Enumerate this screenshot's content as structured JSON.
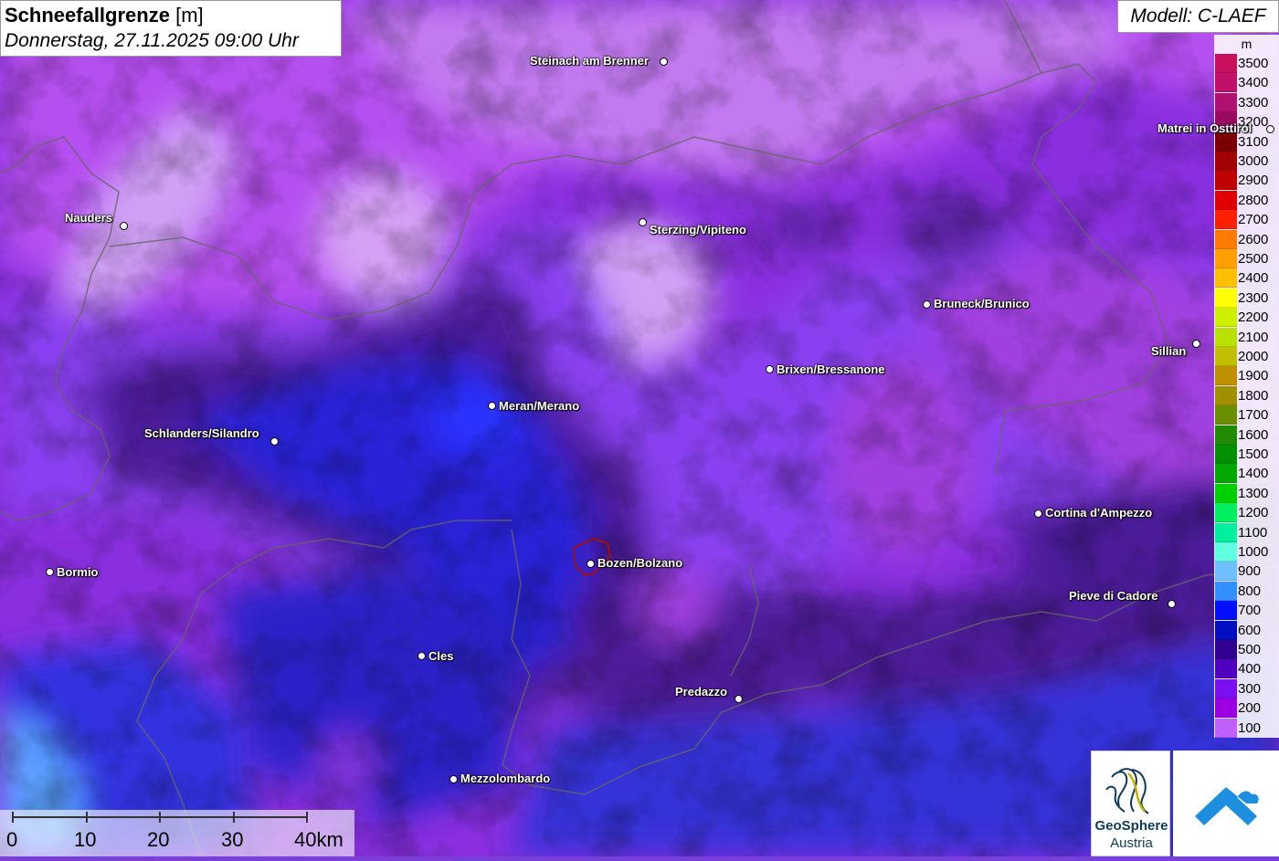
{
  "title": {
    "main": "Schneefallgrenze",
    "unit": "[m]",
    "datetime": "Donnerstag, 27.11.2025 09:00 Uhr"
  },
  "model": "Modell: C-LAEF",
  "legend": {
    "unit": "m",
    "entries": [
      {
        "label": "3500",
        "color": "#c8105c"
      },
      {
        "label": "3400",
        "color": "#c0106a"
      },
      {
        "label": "3300",
        "color": "#b01070"
      },
      {
        "label": "3200",
        "color": "#9a0a60"
      },
      {
        "label": "3100",
        "color": "#7a0000"
      },
      {
        "label": "3000",
        "color": "#a00000"
      },
      {
        "label": "2900",
        "color": "#c00000"
      },
      {
        "label": "2800",
        "color": "#e00000"
      },
      {
        "label": "2700",
        "color": "#ff2000"
      },
      {
        "label": "2600",
        "color": "#ff7a00"
      },
      {
        "label": "2500",
        "color": "#ffa000"
      },
      {
        "label": "2400",
        "color": "#ffc000"
      },
      {
        "label": "2300",
        "color": "#ffff00"
      },
      {
        "label": "2200",
        "color": "#ccf000"
      },
      {
        "label": "2100",
        "color": "#b8e000"
      },
      {
        "label": "2000",
        "color": "#c0c000"
      },
      {
        "label": "1900",
        "color": "#c09000"
      },
      {
        "label": "1800",
        "color": "#a09000"
      },
      {
        "label": "1700",
        "color": "#6a9000"
      },
      {
        "label": "1600",
        "color": "#208a00"
      },
      {
        "label": "1500",
        "color": "#009000"
      },
      {
        "label": "1400",
        "color": "#00a800"
      },
      {
        "label": "1300",
        "color": "#00d000"
      },
      {
        "label": "1200",
        "color": "#00f060"
      },
      {
        "label": "1100",
        "color": "#00f0a0"
      },
      {
        "label": "1000",
        "color": "#60ffe0"
      },
      {
        "label": "900",
        "color": "#70c0ff"
      },
      {
        "label": "800",
        "color": "#3090ff"
      },
      {
        "label": "700",
        "color": "#0010ff"
      },
      {
        "label": "600",
        "color": "#0010c0"
      },
      {
        "label": "500",
        "color": "#300090"
      },
      {
        "label": "400",
        "color": "#5000c0"
      },
      {
        "label": "300",
        "color": "#7a10f0"
      },
      {
        "label": "200",
        "color": "#9a00e0"
      },
      {
        "label": "100",
        "color": "#c060ff"
      }
    ]
  },
  "cities": [
    {
      "name": "Steinach am Brenner"
    },
    {
      "name": "Matrei in Osttirol"
    },
    {
      "name": "Nauders"
    },
    {
      "name": "Sterzing/Vipiteno"
    },
    {
      "name": "Bruneck/Brunico"
    },
    {
      "name": "Sillian"
    },
    {
      "name": "Brixen/Bressanone"
    },
    {
      "name": "Meran/Merano"
    },
    {
      "name": "Schlanders/Silandro"
    },
    {
      "name": "Cortina d'Ampezzo"
    },
    {
      "name": "Bormio"
    },
    {
      "name": "Bozen/Bolzano"
    },
    {
      "name": "Pieve di Cadore"
    },
    {
      "name": "Cles"
    },
    {
      "name": "Predazzo"
    },
    {
      "name": "Mezzolombardo"
    }
  ],
  "scale": {
    "labels": [
      "0",
      "10",
      "20",
      "30",
      "40km"
    ]
  },
  "logos": {
    "geosphere_line1": "GeoSphere",
    "geosphere_line2": "Austria"
  }
}
